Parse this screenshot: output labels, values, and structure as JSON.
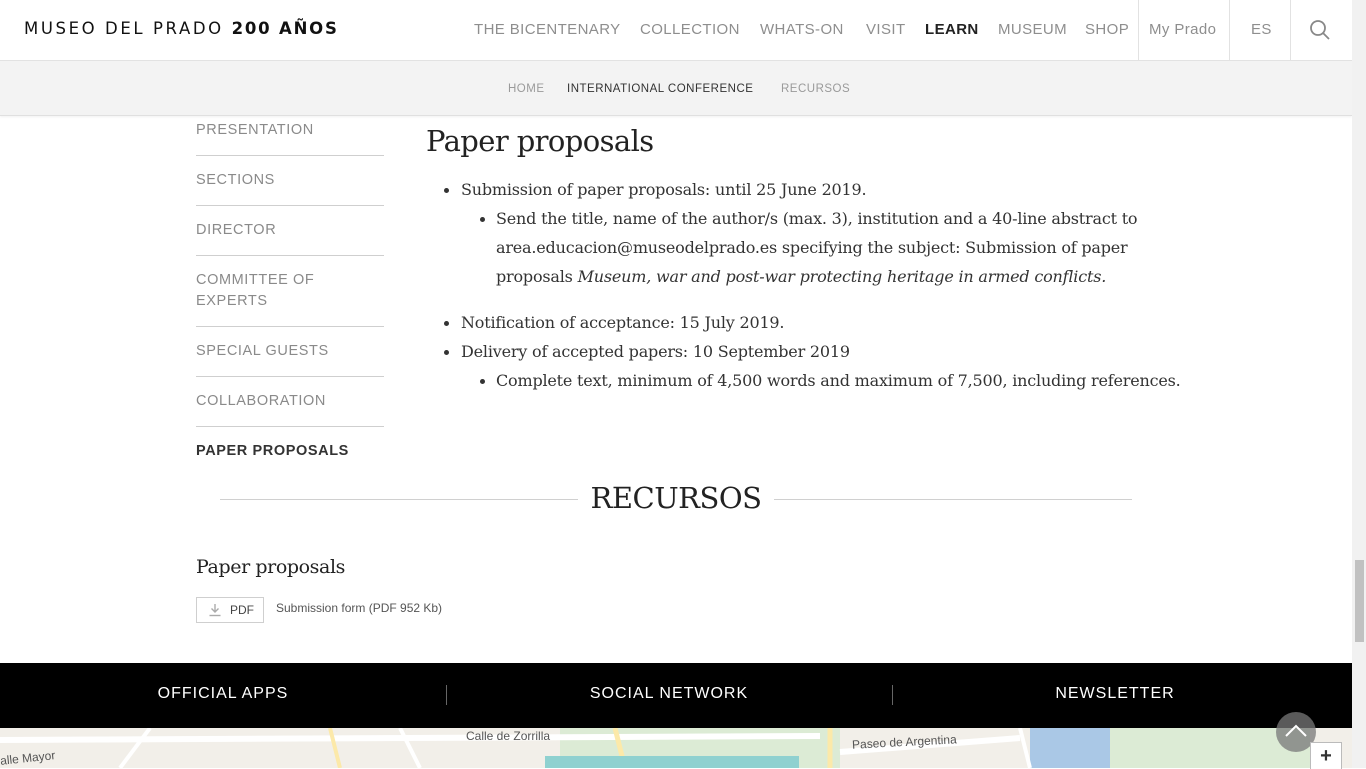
{
  "header": {
    "logo_main": "MUSEO DEL PRADO",
    "logo_bold": "200 AÑOS",
    "nav": [
      "THE BICENTENARY",
      "COLLECTION",
      "WHATS-ON",
      "VISIT",
      "LEARN",
      "MUSEUM",
      "SHOP"
    ],
    "my_prado": "My Prado",
    "lang": "ES"
  },
  "subnav": [
    "HOME",
    "INTERNATIONAL CONFERENCE",
    "RECURSOS"
  ],
  "sidebar": [
    "PRESENTATION",
    "SECTIONS",
    "DIRECTOR",
    "COMMITTEE OF EXPERTS",
    "SPECIAL GUESTS",
    "COLLABORATION",
    "PAPER PROPOSALS"
  ],
  "content": {
    "title": "Paper proposals",
    "item1": "Submission of paper proposals: until 25 June 2019.",
    "item1a_line1": "Send the title, name of the author/s (max. 3), institution and a 40-line abstract to",
    "item1a_line2": "area.educacion@museodelprado.es specifying the subject: Submission of paper",
    "item1a_line3_plain": "proposals ",
    "item1a_line3_italic": "Museum, war and post-war protecting heritage in armed conflicts.",
    "item2": "Notification of acceptance: 15 July 2019.",
    "item3": "Delivery of accepted papers: 10 September 2019",
    "item3a": "Complete text, minimum of 4,500 words and maximum of 7,500, including references."
  },
  "recursos": {
    "title": "RECURSOS",
    "subtitle": "Paper proposals",
    "pdf_label": "PDF",
    "doc_link": "Submission form (PDF 952 Kb)"
  },
  "footer": [
    "OFFICIAL APPS",
    "SOCIAL NETWORK",
    "NEWSLETTER"
  ],
  "map": {
    "labels": [
      "alle Mayor",
      "Calle de Zorrilla",
      "Paseo de Argentina"
    ],
    "zoom_in": "+"
  }
}
